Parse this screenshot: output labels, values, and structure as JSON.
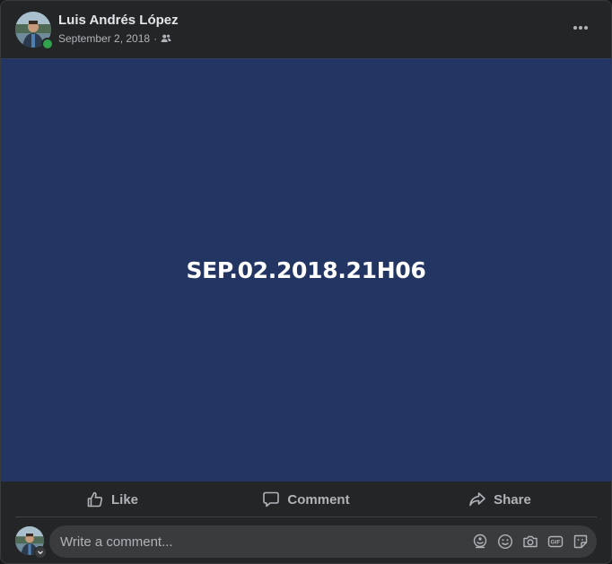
{
  "post": {
    "author": "Luis Andrés López",
    "date": "September 2, 2018",
    "separator": "·",
    "audience_icon": "friends-icon",
    "content_text": "SEP.02.2018.21H06",
    "content_background": "#233562"
  },
  "actions": {
    "like_label": "Like",
    "comment_label": "Comment",
    "share_label": "Share"
  },
  "comment_box": {
    "placeholder": "Write a comment...",
    "tools": [
      "avatar-sticker-icon",
      "emoji-icon",
      "camera-icon",
      "gif-icon",
      "sticker-icon"
    ]
  },
  "colors": {
    "card": "#242526",
    "text_primary": "#e4e6eb",
    "text_secondary": "#b0b3b8",
    "online": "#31a24c"
  }
}
